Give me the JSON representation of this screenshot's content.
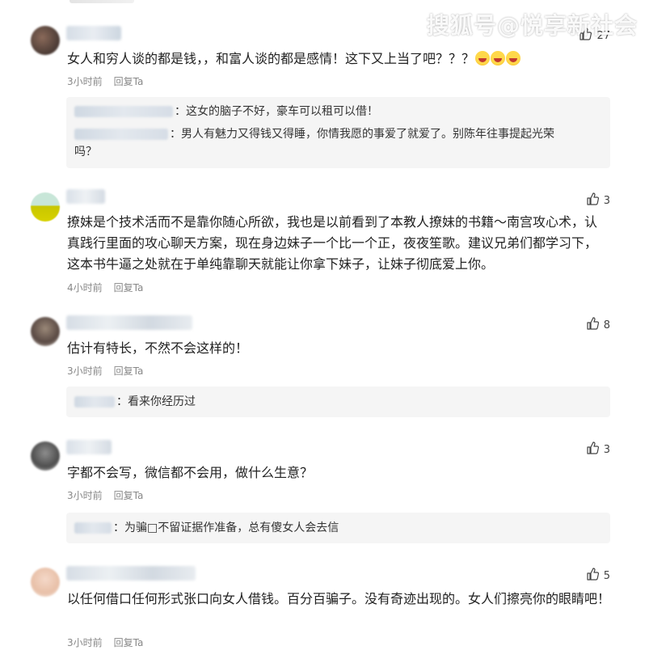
{
  "watermark": "搜狐号@悦享新社会",
  "comments": [
    {
      "likes": "27",
      "text": "女人和穷人谈的都是钱，，和富人谈的都是感情！这下又上当了吧？？？",
      "time": "3小时前",
      "reply_label": "回复Ta",
      "replies": [
        {
          "text": "：这女的脑子不好，豪车可以租可以借！"
        },
        {
          "text": "：男人有魅力又得钱又得睡，你情我愿的事爱了就爱了。别陈年往事提起光荣"
        },
        {
          "text": "吗？"
        }
      ]
    },
    {
      "likes": "3",
      "text": "撩妹是个技术活而不是靠你随心所欲，我也是以前看到了本教人撩妹的书籍～南宫攻心术，认真践行里面的攻心聊天方案，现在身边妹子一个比一个正，夜夜笙歌。建议兄弟们都学习下，这本书牛逼之处就在于单纯靠聊天就能让你拿下妹子，让妹子彻底爱上你。",
      "time": "4小时前",
      "reply_label": "回复Ta"
    },
    {
      "likes": "8",
      "text": "估计有特长，不然不会这样的！",
      "time": "3小时前",
      "reply_label": "回复Ta",
      "replies": [
        {
          "text": "：看来你经历过"
        }
      ]
    },
    {
      "likes": "3",
      "text": "字都不会写，微信都不会用，做什么生意？",
      "time": "3小时前",
      "reply_label": "回复Ta",
      "replies": [
        {
          "text": "：为骗□不留证据作准备，总有傻女人会去信"
        }
      ]
    },
    {
      "likes": "5",
      "text": "以任何借口任何形式张口向女人借钱。百分百骗子。没有奇迹出现的。女人们擦亮你的眼睛吧！",
      "time": "3小时前",
      "reply_label": "回复Ta"
    }
  ]
}
